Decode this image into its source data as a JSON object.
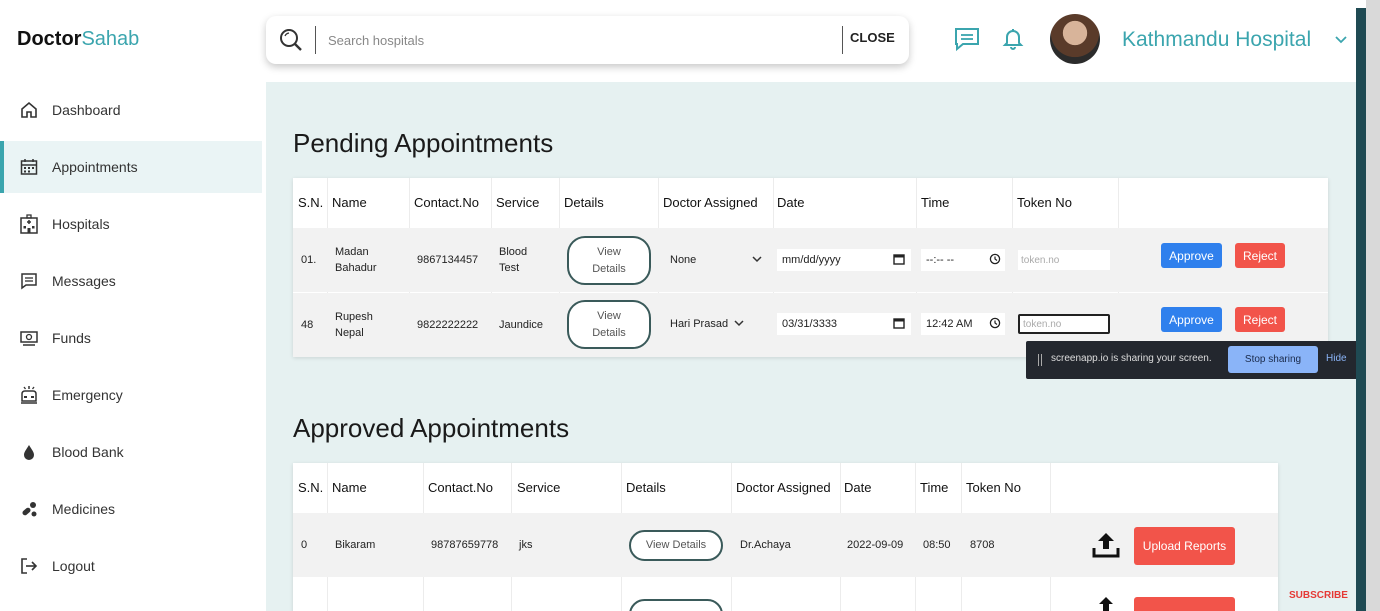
{
  "brand": {
    "part1": "Doctor",
    "part2": "Sahab"
  },
  "sidebar": {
    "items": [
      {
        "label": "Dashboard",
        "icon": "home-icon"
      },
      {
        "label": "Appointments",
        "icon": "calendar-icon",
        "active": true
      },
      {
        "label": "Hospitals",
        "icon": "hospital-icon"
      },
      {
        "label": "Messages",
        "icon": "message-icon"
      },
      {
        "label": "Funds",
        "icon": "funds-icon"
      },
      {
        "label": "Emergency",
        "icon": "ambulance-icon"
      },
      {
        "label": "Blood Bank",
        "icon": "blood-drop-icon"
      },
      {
        "label": "Medicines",
        "icon": "medicine-icon"
      },
      {
        "label": "Logout",
        "icon": "logout-icon"
      }
    ]
  },
  "header": {
    "search_placeholder": "Search hospitals",
    "close_label": "CLOSE",
    "hospital_name": "Kathmandu Hospital"
  },
  "pending": {
    "title": "Pending Appointments",
    "columns": [
      "S.N.",
      "Name",
      "Contact.No",
      "Service",
      "Details",
      "Doctor Assigned",
      "Date",
      "Time",
      "Token No"
    ],
    "rows": [
      {
        "sn": "01.",
        "name": "Madan Bahadur",
        "contact": "9867134457",
        "service": "Blood Test",
        "details": "View Details",
        "doctor": "None",
        "date": "mm/dd/yyyy",
        "time": "--:-- --",
        "token": "token.no",
        "approve": "Approve",
        "reject": "Reject"
      },
      {
        "sn": "48",
        "name": "Rupesh Nepal",
        "contact": "9822222222",
        "service": "Jaundice",
        "details": "View Details",
        "doctor": "Hari Prasad",
        "date": "03/31/3333",
        "time": "12:42 AM",
        "token": "token.no",
        "approve": "Approve",
        "reject": "Reject"
      }
    ]
  },
  "approved": {
    "title": "Approved Appointments",
    "columns": [
      "S.N.",
      "Name",
      "Contact.No",
      "Service",
      "Details",
      "Doctor Assigned",
      "Date",
      "Time",
      "Token No"
    ],
    "rows": [
      {
        "sn": "0",
        "name": "Bikaram",
        "contact": "98787659778",
        "service": "jks",
        "details": "View Details",
        "doctor": "Dr.Achaya",
        "date": "2022-09-09",
        "time": "08:50",
        "token": "8708",
        "upload": "Upload Reports"
      }
    ]
  },
  "share_bar": {
    "message": "screenapp.io is sharing your screen.",
    "stop_label": "Stop sharing",
    "hide_label": "Hide"
  },
  "overlay": {
    "subscribe": "SUBSCRIBE"
  },
  "colors": {
    "accent": "#3ba5ae",
    "approve": "#2f80ed",
    "reject": "#f2544a",
    "main_bg": "#e6f1f1"
  }
}
